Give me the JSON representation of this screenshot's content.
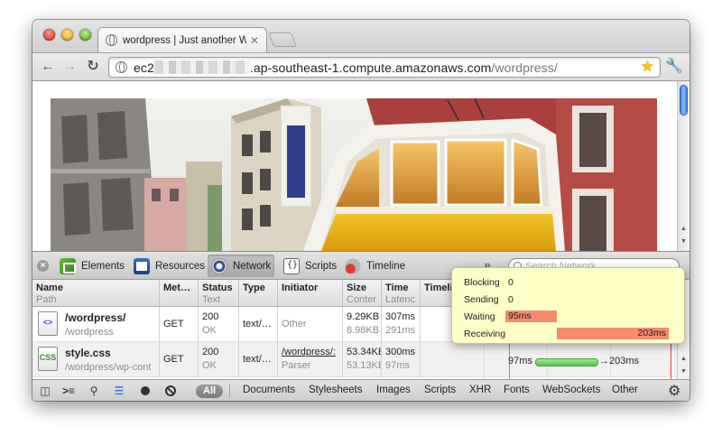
{
  "browser": {
    "tab_title": "wordpress | Just another Wo",
    "tab_close": "✕",
    "url_prefix": "ec2",
    "url_host": ".ap-southeast-1.compute.amazonaws.com",
    "url_path": "/wordpress/"
  },
  "devtools": {
    "close": "×",
    "tabs": [
      {
        "label": "Elements",
        "icon": "elements-icon"
      },
      {
        "label": "Resources",
        "icon": "resources-icon"
      },
      {
        "label": "Network",
        "icon": "network-icon",
        "active": true
      },
      {
        "label": "Scripts",
        "icon": "scripts-icon"
      },
      {
        "label": "Timeline",
        "icon": "timeline-icon"
      }
    ],
    "more": "»",
    "search_placeholder": "Search Network",
    "columns": [
      {
        "label": "Name",
        "sub": "Path"
      },
      {
        "label": "Met…",
        "sub": ""
      },
      {
        "label": "Status",
        "sub": "Text"
      },
      {
        "label": "Type",
        "sub": ""
      },
      {
        "label": "Initiator",
        "sub": ""
      },
      {
        "label": "Size",
        "sub": "Conter"
      },
      {
        "label": "Time",
        "sub": "Latenc"
      },
      {
        "label": "Timeli",
        "sub": ""
      }
    ],
    "rows": [
      {
        "icon": "html-file-icon",
        "icon_text": "<>",
        "name": "/wordpress/",
        "path": "/wordpress",
        "method": "GET",
        "status": "200",
        "status_text": "OK",
        "type": "text/…",
        "initiator": "Other",
        "initiator_sub": "",
        "size": "9.29KB",
        "content": "8.98KB",
        "time": "307ms",
        "latency": "291ms"
      },
      {
        "icon": "css-file-icon",
        "icon_text": "CSS",
        "name": "style.css",
        "path": "/wordpress/wp-cont",
        "method": "GET",
        "status": "200",
        "status_text": "OK",
        "type": "text/…",
        "initiator": "/wordpress/:",
        "initiator_sub": "Parser",
        "size": "53.34KB",
        "content": "53.13KB",
        "time": "300ms",
        "latency": "97ms"
      }
    ],
    "timeline_left_label": "97ms",
    "timeline_right_label": "203ms",
    "popover": {
      "blocking_label": "Blocking",
      "blocking_value": "0",
      "sending_label": "Sending",
      "sending_value": "0",
      "waiting_label": "Waiting",
      "waiting_value": "95ms",
      "receiving_label": "Receiving",
      "receiving_value": "203ms"
    },
    "filters": {
      "all": "All",
      "items": [
        "Documents",
        "Stylesheets",
        "Images",
        "Scripts",
        "XHR",
        "Fonts",
        "WebSockets",
        "Other"
      ]
    }
  },
  "colors": {
    "timing_bar": "#f58c6b",
    "popover_bg": "#ffffc8",
    "receive_bar": "#56c147"
  }
}
